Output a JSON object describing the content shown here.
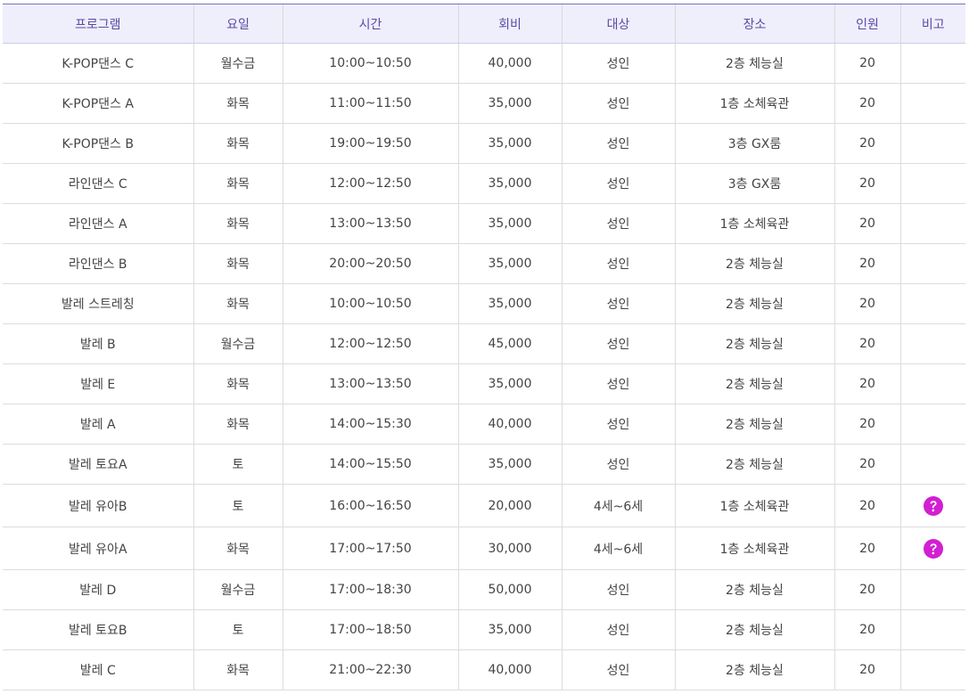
{
  "table": {
    "headers": [
      "프로그램",
      "요일",
      "시간",
      "회비",
      "대상",
      "장소",
      "인원",
      "비고"
    ],
    "rows": [
      {
        "program": "K-POP댄스 C",
        "days": "월수금",
        "time": "10:00~10:50",
        "fee": "40,000",
        "target": "성인",
        "place": "2층 체능실",
        "capacity": "20",
        "note_icon": ""
      },
      {
        "program": "K-POP댄스 A",
        "days": "화목",
        "time": "11:00~11:50",
        "fee": "35,000",
        "target": "성인",
        "place": "1층 소체육관",
        "capacity": "20",
        "note_icon": ""
      },
      {
        "program": "K-POP댄스 B",
        "days": "화목",
        "time": "19:00~19:50",
        "fee": "35,000",
        "target": "성인",
        "place": "3층 GX룸",
        "capacity": "20",
        "note_icon": ""
      },
      {
        "program": "라인댄스 C",
        "days": "화목",
        "time": "12:00~12:50",
        "fee": "35,000",
        "target": "성인",
        "place": "3층 GX룸",
        "capacity": "20",
        "note_icon": ""
      },
      {
        "program": "라인댄스 A",
        "days": "화목",
        "time": "13:00~13:50",
        "fee": "35,000",
        "target": "성인",
        "place": "1층 소체육관",
        "capacity": "20",
        "note_icon": ""
      },
      {
        "program": "라인댄스 B",
        "days": "화목",
        "time": "20:00~20:50",
        "fee": "35,000",
        "target": "성인",
        "place": "2층 체능실",
        "capacity": "20",
        "note_icon": ""
      },
      {
        "program": "발레 스트레칭",
        "days": "화목",
        "time": "10:00~10:50",
        "fee": "35,000",
        "target": "성인",
        "place": "2층 체능실",
        "capacity": "20",
        "note_icon": ""
      },
      {
        "program": "발레 B",
        "days": "월수금",
        "time": "12:00~12:50",
        "fee": "45,000",
        "target": "성인",
        "place": "2층 체능실",
        "capacity": "20",
        "note_icon": ""
      },
      {
        "program": "발레 E",
        "days": "화목",
        "time": "13:00~13:50",
        "fee": "35,000",
        "target": "성인",
        "place": "2층 체능실",
        "capacity": "20",
        "note_icon": ""
      },
      {
        "program": "발레 A",
        "days": "화목",
        "time": "14:00~15:30",
        "fee": "40,000",
        "target": "성인",
        "place": "2층 체능실",
        "capacity": "20",
        "note_icon": ""
      },
      {
        "program": "발레 토요A",
        "days": "토",
        "time": "14:00~15:50",
        "fee": "35,000",
        "target": "성인",
        "place": "2층 체능실",
        "capacity": "20",
        "note_icon": ""
      },
      {
        "program": "발레 유아B",
        "days": "토",
        "time": "16:00~16:50",
        "fee": "20,000",
        "target": "4세~6세",
        "place": "1층 소체육관",
        "capacity": "20",
        "note_icon": "help-circle-icon"
      },
      {
        "program": "발레 유아A",
        "days": "화목",
        "time": "17:00~17:50",
        "fee": "30,000",
        "target": "4세~6세",
        "place": "1층 소체육관",
        "capacity": "20",
        "note_icon": "help-circle-icon"
      },
      {
        "program": "발레 D",
        "days": "월수금",
        "time": "17:00~18:30",
        "fee": "50,000",
        "target": "성인",
        "place": "2층 체능실",
        "capacity": "20",
        "note_icon": ""
      },
      {
        "program": "발레 토요B",
        "days": "토",
        "time": "17:00~18:50",
        "fee": "35,000",
        "target": "성인",
        "place": "2층 체능실",
        "capacity": "20",
        "note_icon": ""
      },
      {
        "program": "발레 C",
        "days": "화목",
        "time": "21:00~22:30",
        "fee": "40,000",
        "target": "성인",
        "place": "2층 체능실",
        "capacity": "20",
        "note_icon": ""
      }
    ]
  },
  "colors": {
    "header_bg": "#efeefb",
    "header_text": "#5b4aa6",
    "header_top_border": "#7e71c4",
    "help_icon": "#d21fd2"
  }
}
